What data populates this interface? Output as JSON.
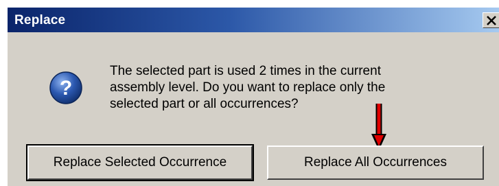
{
  "window": {
    "title": "Replace",
    "close_icon": "close-x-icon"
  },
  "icon": {
    "name": "question-icon",
    "glyph": "?",
    "color": "#2b58b0"
  },
  "message": {
    "lines": [
      "The selected part is used 2 times in the current",
      "assembly level.  Do you want to replace only the",
      "selected part or all occurrences?"
    ]
  },
  "buttons": {
    "replace_selected": "Replace Selected Occurrence",
    "replace_all": "Replace All Occurrences"
  },
  "annotation": {
    "arrow_icon": "down-arrow-icon",
    "arrow_color": "#e00000"
  }
}
